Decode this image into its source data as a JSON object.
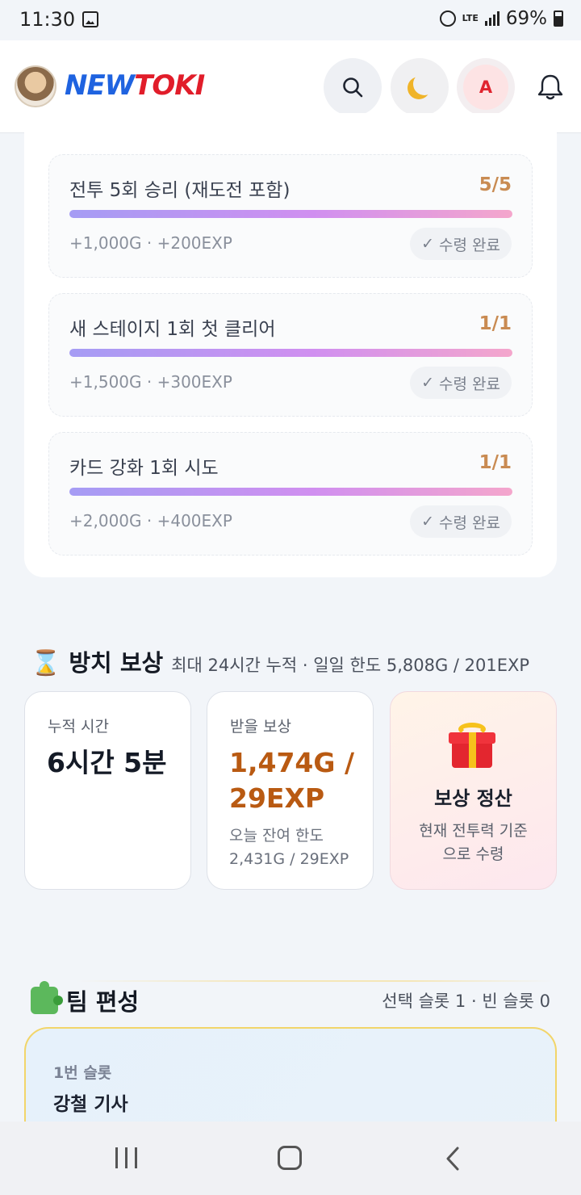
{
  "status_bar": {
    "time": "11:30",
    "network": "LTE",
    "battery": "69%"
  },
  "header": {
    "logo_part1": "NEW",
    "logo_part2": "TOKI",
    "avatar_letter": "A",
    "colors": {
      "logo_blue": "#1f63e0",
      "logo_red": "#e11d2a"
    }
  },
  "quests": [
    {
      "title": "전투 5회 승리 (재도전 포함)",
      "count": "5/5",
      "progress": 1.0,
      "reward": "+1,000G · +200EXP",
      "claim_label": "수령 완료"
    },
    {
      "title": "새 스테이지 1회 첫 클리어",
      "count": "1/1",
      "progress": 1.0,
      "reward": "+1,500G · +300EXP",
      "claim_label": "수령 완료"
    },
    {
      "title": "카드 강화 1회 시도",
      "count": "1/1",
      "progress": 1.0,
      "reward": "+2,000G · +400EXP",
      "claim_label": "수령 완료"
    }
  ],
  "idle_reward": {
    "icon": "⌛",
    "title": "방치 보상",
    "subtitle": "최대 24시간 누적 · 일일 한도 5,808G / 201EXP",
    "accumulated": {
      "label": "누적 시간",
      "value": "6시간 5분"
    },
    "receivable": {
      "label": "받을 보상",
      "value_line1": "1,474G /",
      "value_line2": "29EXP",
      "note_line1": "오늘 잔여 한도",
      "note_line2": "2,431G / 29EXP"
    },
    "settle": {
      "title": "보상 정산",
      "note_line1": "현재 전투력 기준",
      "note_line2": "으로 수령"
    }
  },
  "team": {
    "title": "팀 편성",
    "summary": "선택 슬롯 1 · 빈 슬롯 0",
    "slots": [
      {
        "label": "1번 슬롯",
        "name": "강철 기사"
      }
    ]
  }
}
